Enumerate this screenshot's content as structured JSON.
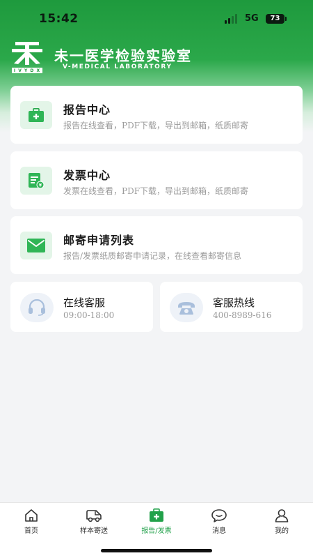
{
  "status_bar": {
    "time": "15:42",
    "network": "5G",
    "battery": "73"
  },
  "brand": {
    "name_cn": "未一医学检验实验室",
    "name_en": "V-MEDICAL LABORATORY",
    "logo_caption": "I V Y D X"
  },
  "cards": [
    {
      "title": "报告中心",
      "desc": "报告在线查看，PDF下载，导出到邮箱，纸质邮寄",
      "icon": "medical-kit-icon"
    },
    {
      "title": "发票中心",
      "desc": "发票在线查看，PDF下载，导出到邮箱，纸质邮寄",
      "icon": "invoice-icon"
    },
    {
      "title": "邮寄申请列表",
      "desc": "报告/发票纸质邮寄申请记录，在线查看邮寄信息",
      "icon": "mail-envelope-icon"
    }
  ],
  "service": {
    "online": {
      "title": "在线客服",
      "hours": "09:00-18:00",
      "icon": "headset-icon"
    },
    "hotline": {
      "title": "客服热线",
      "phone": "400-8989-616",
      "icon": "telephone-icon"
    }
  },
  "tabs": [
    {
      "label": "首页",
      "icon": "home-icon"
    },
    {
      "label": "样本寄送",
      "icon": "delivery-van-icon"
    },
    {
      "label": "报告/发票",
      "icon": "report-kit-icon",
      "active": true
    },
    {
      "label": "消息",
      "icon": "chat-bubble-icon"
    },
    {
      "label": "我的",
      "icon": "user-icon"
    }
  ],
  "colors": {
    "brand_green": "#22a14a",
    "icon_bg": "#e3f5e8",
    "page_bg": "#f3f4f6"
  }
}
